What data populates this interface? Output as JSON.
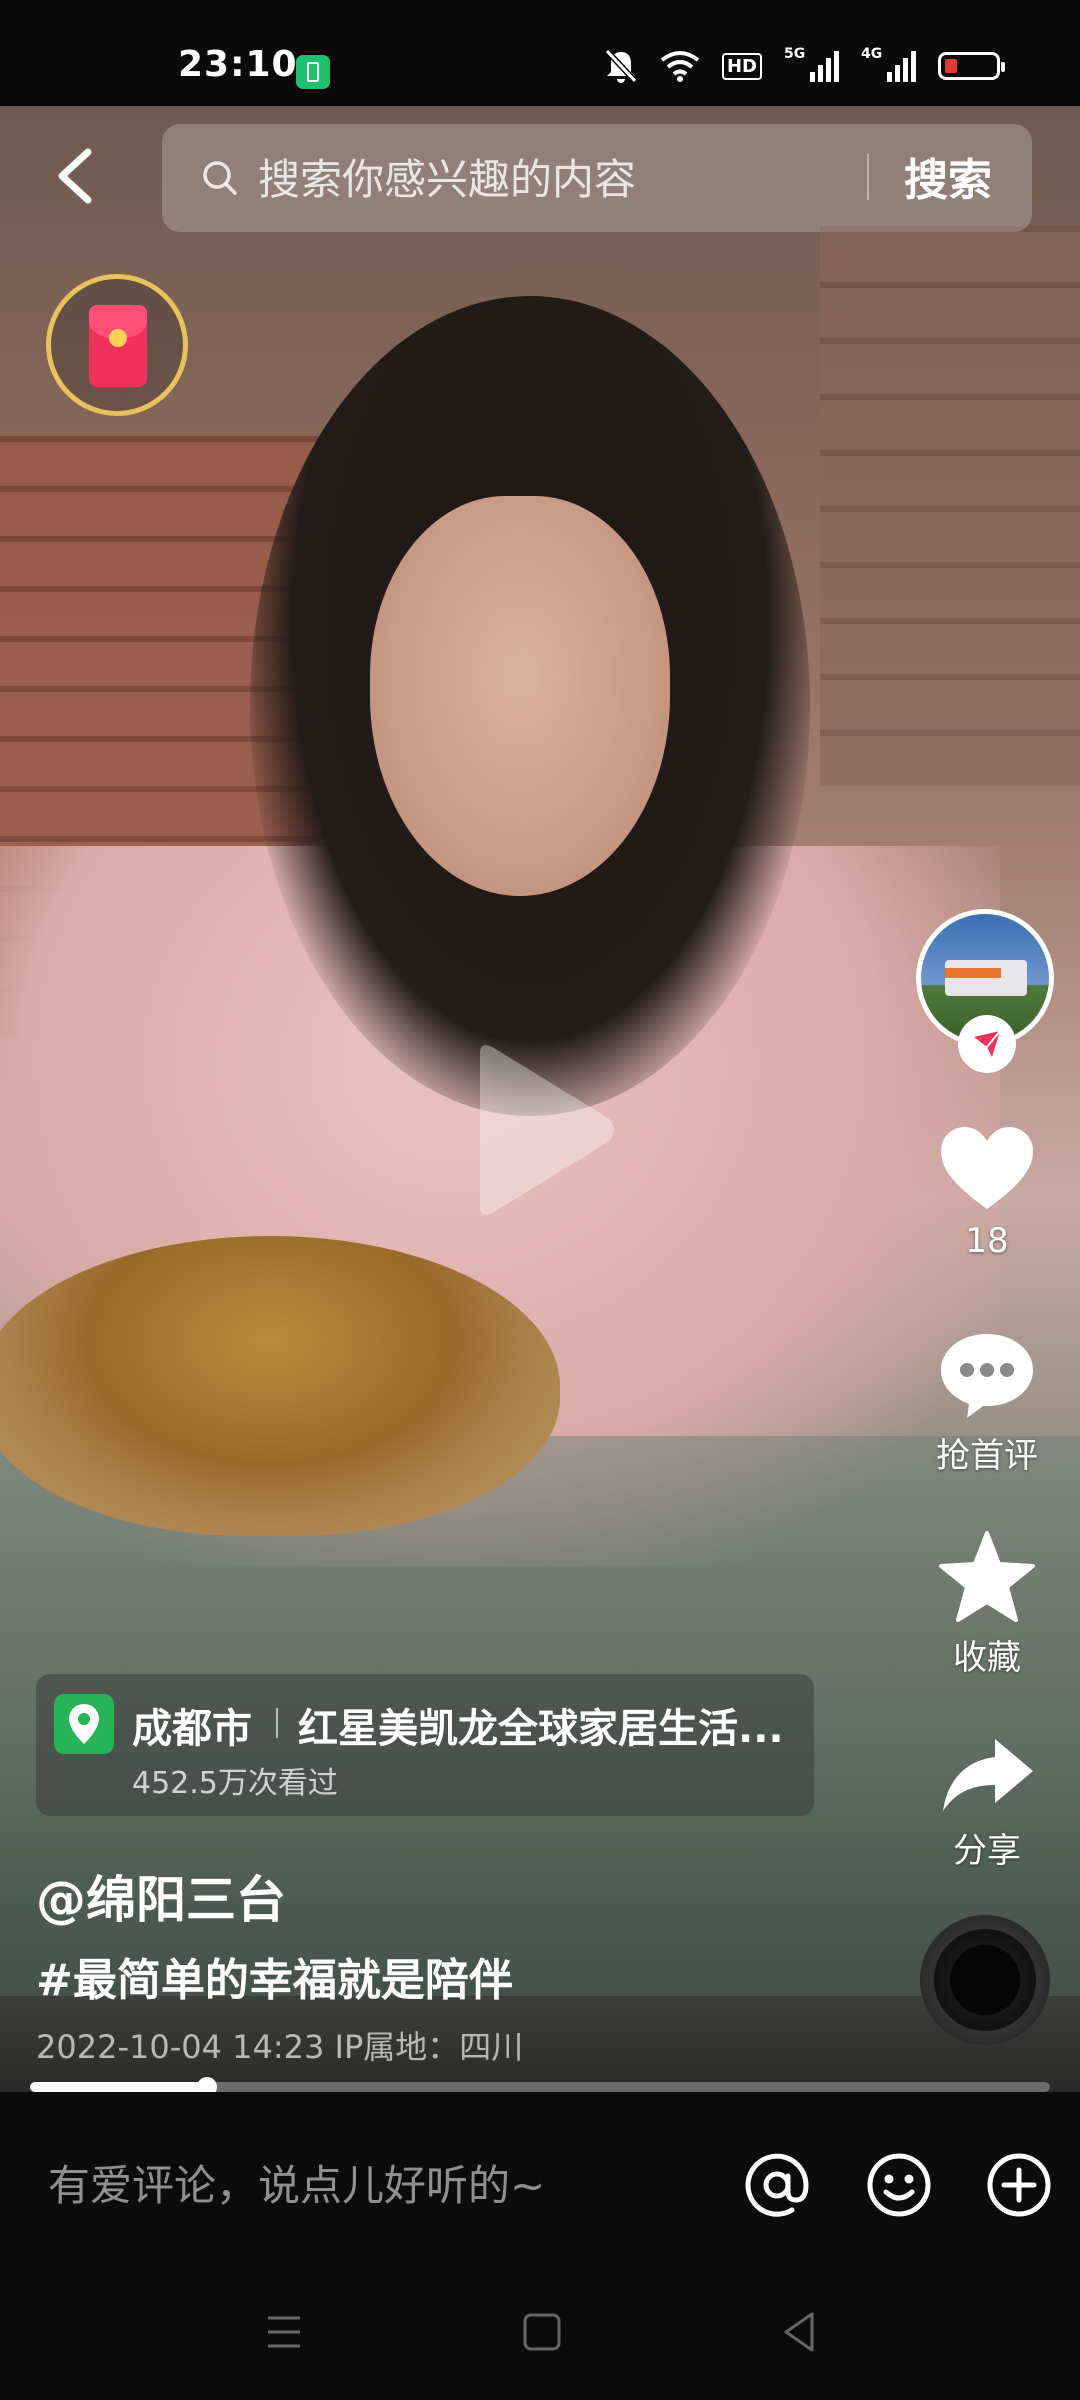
{
  "status_bar": {
    "time": "23:10",
    "icons": [
      "battery-saver-icon",
      "mute-icon",
      "wifi-icon",
      "hd-icon",
      "signal-5g-icon",
      "signal-4g-icon",
      "battery-icon"
    ],
    "hd_label": "HD",
    "signal1_label": "5G",
    "signal2_label": "4G"
  },
  "search": {
    "placeholder": "搜索你感兴趣的内容",
    "button_label": "搜索"
  },
  "side_actions": {
    "likes": "18",
    "comment_label": "抢首评",
    "favorite_label": "收藏",
    "share_label": "分享"
  },
  "location": {
    "city": "成都市",
    "place": "红星美凯龙全球家居生活...",
    "views": "452.5万次看过"
  },
  "post": {
    "author": "@绵阳三台",
    "caption": "#最简单的幸福就是陪伴",
    "meta": "2022-10-04 14:23  IP属地：四川"
  },
  "playback": {
    "progress": 0.174
  },
  "comment_bar": {
    "placeholder": "有爱评论，说点儿好听的~"
  },
  "colors": {
    "accent_red": "#f0325a",
    "location_green": "#27b358",
    "gold_ring": "#e8c25c"
  }
}
